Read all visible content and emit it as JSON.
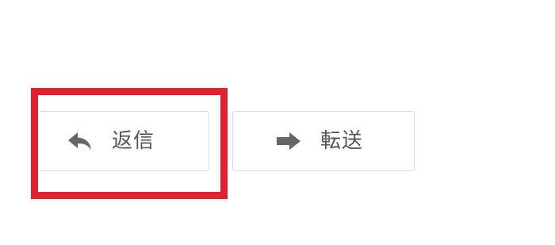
{
  "toolbar": {
    "reply": {
      "label": "返信",
      "icon": "reply-icon"
    },
    "forward": {
      "label": "転送",
      "icon": "arrow-right-icon"
    }
  },
  "colors": {
    "highlight": "#e3202b",
    "icon": "#666666",
    "text": "#555555",
    "border": "#d9d9d9"
  }
}
